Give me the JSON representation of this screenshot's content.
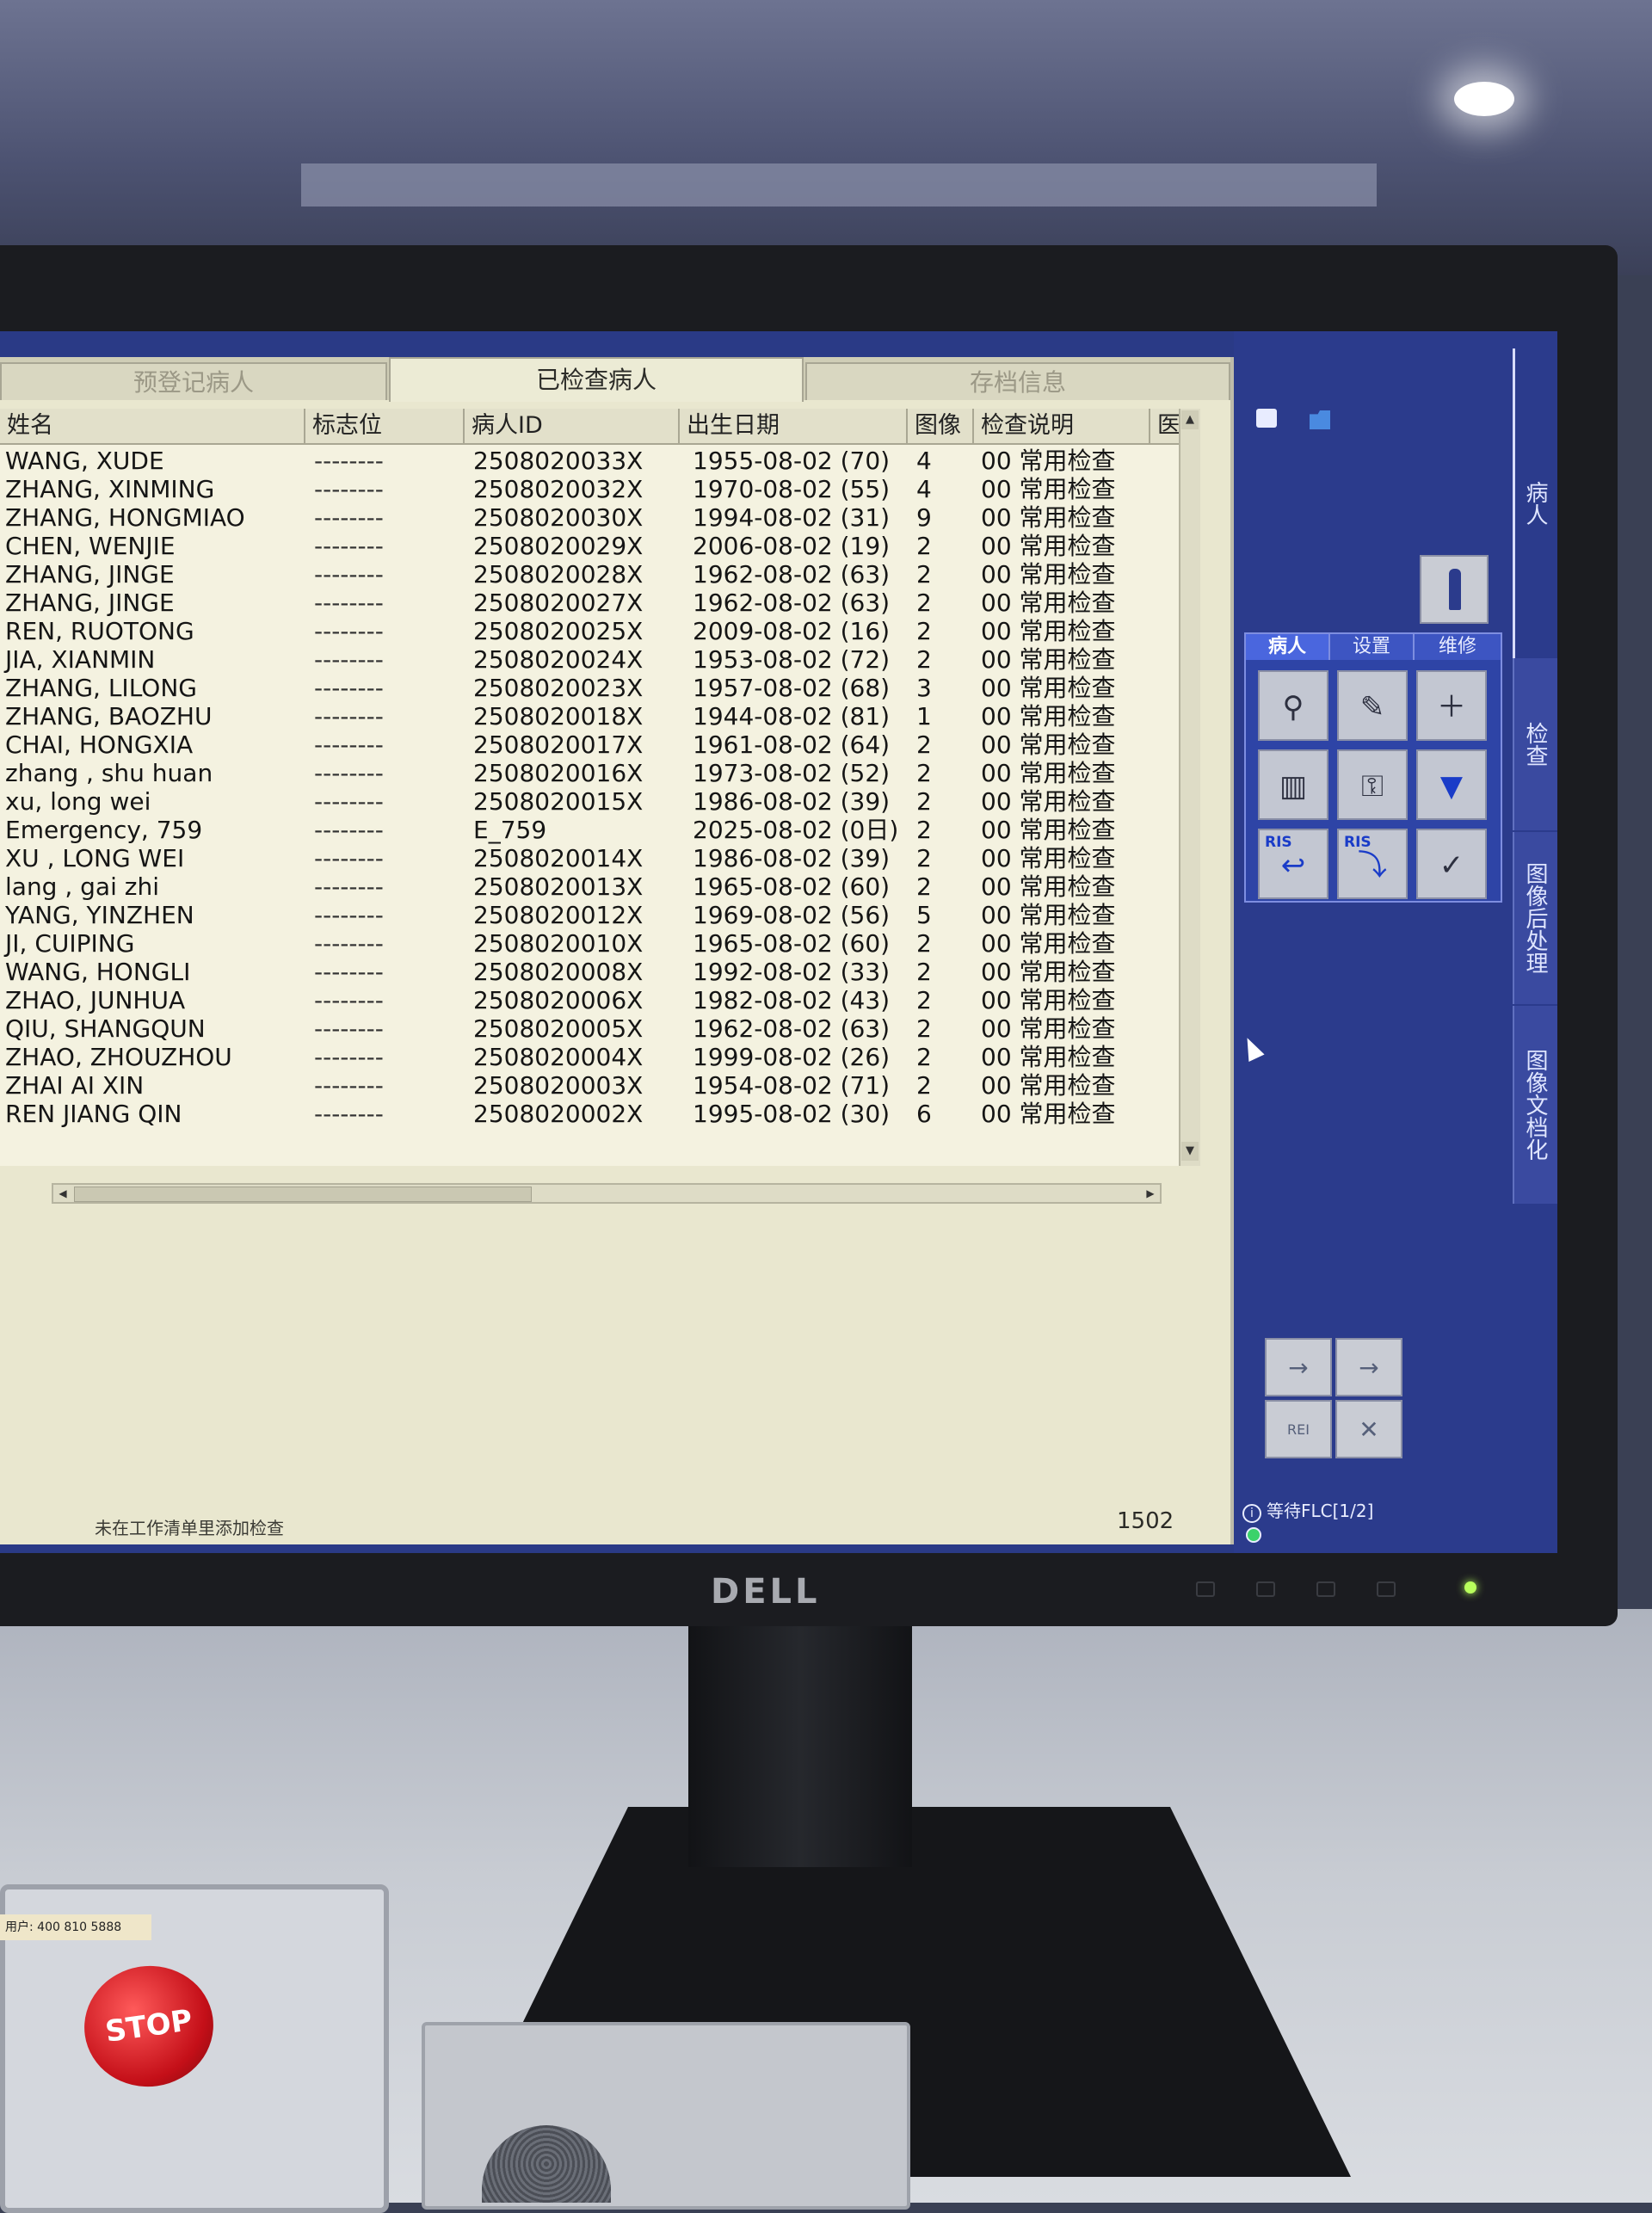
{
  "tabs": [
    "预登记病人",
    "已检查病人",
    "存档信息"
  ],
  "active_tab": 1,
  "columns": [
    "姓名",
    "标志位",
    "病人ID",
    "出生日期",
    "图像",
    "检查说明",
    "医"
  ],
  "patients": [
    {
      "name": "WANG, XUDE",
      "flag": "--------",
      "id": "2508020033X",
      "dob": "1955-08-02 (70)",
      "images": "4",
      "desc": "00 常用检查"
    },
    {
      "name": "ZHANG, XINMING",
      "flag": "--------",
      "id": "2508020032X",
      "dob": "1970-08-02 (55)",
      "images": "4",
      "desc": "00 常用检查"
    },
    {
      "name": "ZHANG, HONGMIAO",
      "flag": "--------",
      "id": "2508020030X",
      "dob": "1994-08-02 (31)",
      "images": "9",
      "desc": "00 常用检查"
    },
    {
      "name": "CHEN, WENJIE",
      "flag": "--------",
      "id": "2508020029X",
      "dob": "2006-08-02 (19)",
      "images": "2",
      "desc": "00 常用检查"
    },
    {
      "name": "ZHANG, JINGE",
      "flag": "--------",
      "id": "2508020028X",
      "dob": "1962-08-02 (63)",
      "images": "2",
      "desc": "00 常用检查"
    },
    {
      "name": "ZHANG, JINGE",
      "flag": "--------",
      "id": "2508020027X",
      "dob": "1962-08-02 (63)",
      "images": "2",
      "desc": "00 常用检查"
    },
    {
      "name": "REN, RUOTONG",
      "flag": "--------",
      "id": "2508020025X",
      "dob": "2009-08-02 (16)",
      "images": "2",
      "desc": "00 常用检查"
    },
    {
      "name": "JIA, XIANMIN",
      "flag": "--------",
      "id": "2508020024X",
      "dob": "1953-08-02 (72)",
      "images": "2",
      "desc": "00 常用检查"
    },
    {
      "name": "ZHANG, LILONG",
      "flag": "--------",
      "id": "2508020023X",
      "dob": "1957-08-02 (68)",
      "images": "3",
      "desc": "00 常用检查"
    },
    {
      "name": "ZHANG, BAOZHU",
      "flag": "--------",
      "id": "2508020018X",
      "dob": "1944-08-02 (81)",
      "images": "1",
      "desc": "00 常用检查"
    },
    {
      "name": "CHAI, HONGXIA",
      "flag": "--------",
      "id": "2508020017X",
      "dob": "1961-08-02 (64)",
      "images": "2",
      "desc": "00 常用检查"
    },
    {
      "name": "zhang , shu huan",
      "flag": "--------",
      "id": "2508020016X",
      "dob": "1973-08-02 (52)",
      "images": "2",
      "desc": "00 常用检查"
    },
    {
      "name": "xu, long wei",
      "flag": "--------",
      "id": "2508020015X",
      "dob": "1986-08-02 (39)",
      "images": "2",
      "desc": "00 常用检查"
    },
    {
      "name": "Emergency, 759",
      "flag": "--------",
      "id": "E_759",
      "dob": "2025-08-02 (0日)",
      "images": "2",
      "desc": "00 常用检查"
    },
    {
      "name": "XU , LONG WEI",
      "flag": "--------",
      "id": "2508020014X",
      "dob": "1986-08-02 (39)",
      "images": "2",
      "desc": "00 常用检查"
    },
    {
      "name": "lang , gai zhi",
      "flag": "--------",
      "id": "2508020013X",
      "dob": "1965-08-02 (60)",
      "images": "2",
      "desc": "00 常用检查"
    },
    {
      "name": "YANG, YINZHEN",
      "flag": "--------",
      "id": "2508020012X",
      "dob": "1969-08-02 (56)",
      "images": "5",
      "desc": "00 常用检查"
    },
    {
      "name": "JI, CUIPING",
      "flag": "--------",
      "id": "2508020010X",
      "dob": "1965-08-02 (60)",
      "images": "2",
      "desc": "00 常用检查"
    },
    {
      "name": "WANG, HONGLI",
      "flag": "--------",
      "id": "2508020008X",
      "dob": "1992-08-02 (33)",
      "images": "2",
      "desc": "00 常用检查"
    },
    {
      "name": "ZHAO, JUNHUA",
      "flag": "--------",
      "id": "2508020006X",
      "dob": "1982-08-02 (43)",
      "images": "2",
      "desc": "00 常用检查"
    },
    {
      "name": "QIU, SHANGQUN",
      "flag": "--------",
      "id": "2508020005X",
      "dob": "1962-08-02 (63)",
      "images": "2",
      "desc": "00 常用检查"
    },
    {
      "name": "ZHAO, ZHOUZHOU",
      "flag": "--------",
      "id": "2508020004X",
      "dob": "1999-08-02 (26)",
      "images": "2",
      "desc": "00 常用检查"
    },
    {
      "name": "ZHAI AI XIN",
      "flag": "--------",
      "id": "2508020003X",
      "dob": "1954-08-02 (71)",
      "images": "2",
      "desc": "00 常用检查"
    },
    {
      "name": "REN JIANG QIN",
      "flag": "--------",
      "id": "2508020002X",
      "dob": "1995-08-02 (30)",
      "images": "6",
      "desc": "00 常用检查"
    }
  ],
  "status_message": "未在工作清单里添加检查",
  "record_count": "1502",
  "side_vertical_tabs": [
    "病人",
    "检查",
    "图像后处理",
    "图像文档化"
  ],
  "tool_tabs": [
    "病人",
    "设置",
    "维修"
  ],
  "ris_label": "RIS",
  "rei_label": "REI",
  "side_status": "等待FLC[1/2]",
  "brand": "DELL",
  "stop_label": "STOP",
  "hotline": "用户: 400 810 5888",
  "colors": {
    "screen_bg": "#2a3a86",
    "panel_bg": "#e9e7cf",
    "grid_bg": "#f4f2e0",
    "accent": "#4a66de"
  }
}
